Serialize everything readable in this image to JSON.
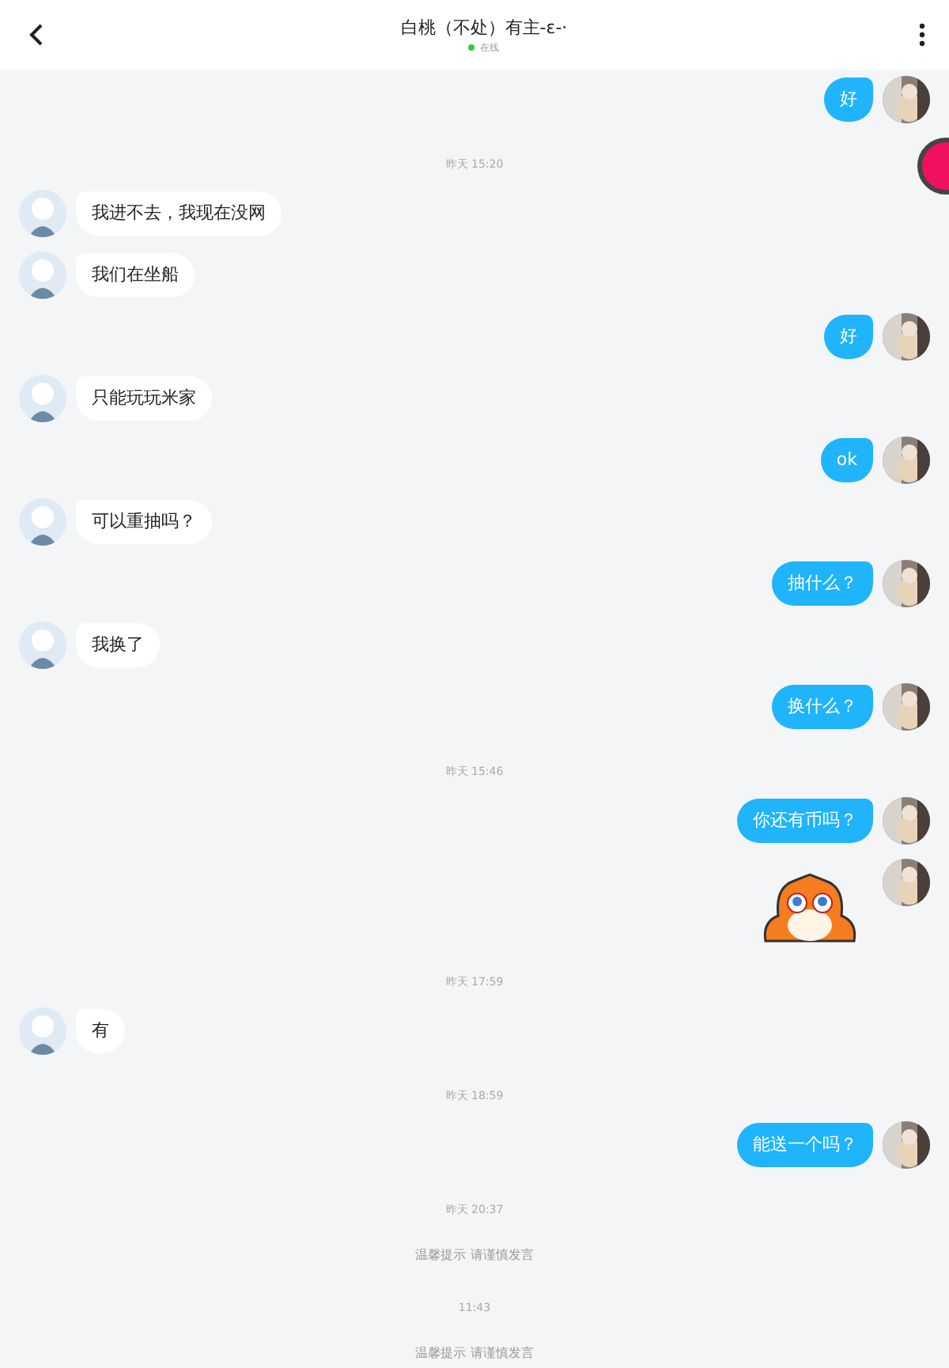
{
  "header": {
    "title": "白桃（不处）有主-ε-·",
    "status": "在线",
    "online": true
  },
  "messages": [
    {
      "kind": "outgoing",
      "text": "好"
    },
    {
      "kind": "time",
      "text": "昨天 15:20"
    },
    {
      "kind": "incoming",
      "text": "我进不去，我现在没网"
    },
    {
      "kind": "incoming",
      "text": "我们在坐船"
    },
    {
      "kind": "outgoing",
      "text": "好"
    },
    {
      "kind": "incoming",
      "text": "只能玩玩米家"
    },
    {
      "kind": "outgoing",
      "text": "ok"
    },
    {
      "kind": "incoming",
      "text": "可以重抽吗？"
    },
    {
      "kind": "outgoing",
      "text": "抽什么？"
    },
    {
      "kind": "incoming",
      "text": "我换了"
    },
    {
      "kind": "outgoing",
      "text": "换什么？"
    },
    {
      "kind": "time",
      "text": "昨天 15:46"
    },
    {
      "kind": "outgoing",
      "text": "你还有币吗？"
    },
    {
      "kind": "sticker"
    },
    {
      "kind": "time",
      "text": "昨天 17:59"
    },
    {
      "kind": "incoming",
      "text": "有"
    },
    {
      "kind": "time",
      "text": "昨天 18:59"
    },
    {
      "kind": "outgoing",
      "text": "能送一个吗？"
    },
    {
      "kind": "time",
      "text": "昨天 20:37"
    },
    {
      "kind": "notice",
      "text": "温馨提示 请谨慎发言"
    },
    {
      "kind": "time",
      "text": "11:43"
    },
    {
      "kind": "notice",
      "text": "温馨提示 请谨慎发言"
    }
  ]
}
